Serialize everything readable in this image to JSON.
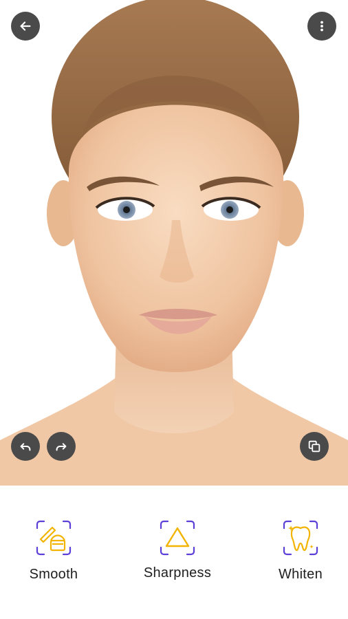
{
  "toolbar": {
    "back_icon": "arrow-left-icon",
    "more_icon": "more-vertical-icon",
    "undo_icon": "undo-icon",
    "redo_icon": "redo-icon",
    "compare_icon": "compare-icon"
  },
  "tools": [
    {
      "label": "Smooth",
      "icon": "smooth-cream-icon"
    },
    {
      "label": "Sharpness",
      "icon": "triangle-sharpness-icon"
    },
    {
      "label": "Whiten",
      "icon": "tooth-whiten-icon"
    }
  ],
  "colors": {
    "button_bg": "#4a4a4a",
    "icon_frame": "#5b3fd6",
    "icon_accent": "#f2b400",
    "skin": "#f2c9a8"
  }
}
